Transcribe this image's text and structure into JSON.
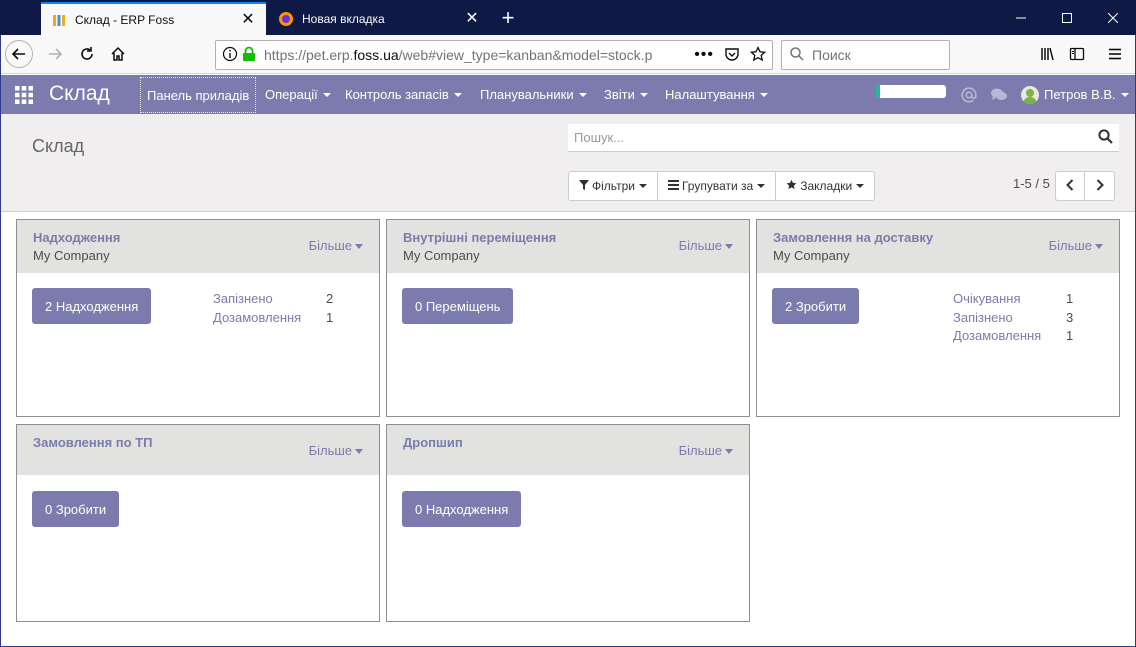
{
  "browser": {
    "active_tab_title": "Склад - ERP Foss",
    "inactive_tab_title": "Новая вкладка",
    "url_prefix": "https://pet.erp.",
    "url_domain": "foss.ua",
    "url_suffix": "/web#view_type=kanban&model=stock.p",
    "search_placeholder": "Поиск",
    "icons": [
      "back-icon",
      "forward-icon",
      "reload-icon",
      "home-icon",
      "info-icon",
      "lock-icon",
      "more-icon",
      "pocket-icon",
      "star-icon",
      "search-icon",
      "library-icon",
      "sidebar-icon",
      "hamburger-icon",
      "new-tab-icon",
      "minimize-icon",
      "maximize-icon",
      "close-icon"
    ]
  },
  "app": {
    "brand": "Склад",
    "menu": {
      "dashboard": "Панель приладів",
      "operations": "Операції",
      "inventory_control": "Контроль запасів",
      "schedulers": "Планувальники",
      "reports": "Звіти",
      "settings": "Налаштування"
    },
    "progress_fraction": 0.05,
    "user_name": "Петров В.В.",
    "accent_color": "#7c7bad"
  },
  "control_panel": {
    "breadcrumb": "Склад",
    "search_placeholder": "Пошук...",
    "filters_label": "Фільтри",
    "group_by_label": "Групувати за",
    "favorites_label": "Закладки",
    "pager_text": "1-5 / 5"
  },
  "cards": [
    {
      "title": "Надходження",
      "company": "My Company",
      "more": "Більше",
      "action": "2 Надходження",
      "stats": [
        {
          "label": "Запізнено",
          "value": "2"
        },
        {
          "label": "Дозамовлення",
          "value": "1"
        }
      ]
    },
    {
      "title": "Внутрішні переміщення",
      "company": "My Company",
      "more": "Більше",
      "action": "0 Переміщень",
      "stats": []
    },
    {
      "title": "Замовлення на доставку",
      "company": "My Company",
      "more": "Більше",
      "action": "2 Зробити",
      "stats": [
        {
          "label": "Очікування",
          "value": "1"
        },
        {
          "label": "Запізнено",
          "value": "3"
        },
        {
          "label": "Дозамовлення",
          "value": "1"
        }
      ]
    },
    {
      "title": "Замовлення по ТП",
      "company": "",
      "more": "Більше",
      "action": "0 Зробити",
      "stats": []
    },
    {
      "title": "Дропшип",
      "company": "",
      "more": "Більше",
      "action": "0 Надходження",
      "stats": []
    }
  ]
}
